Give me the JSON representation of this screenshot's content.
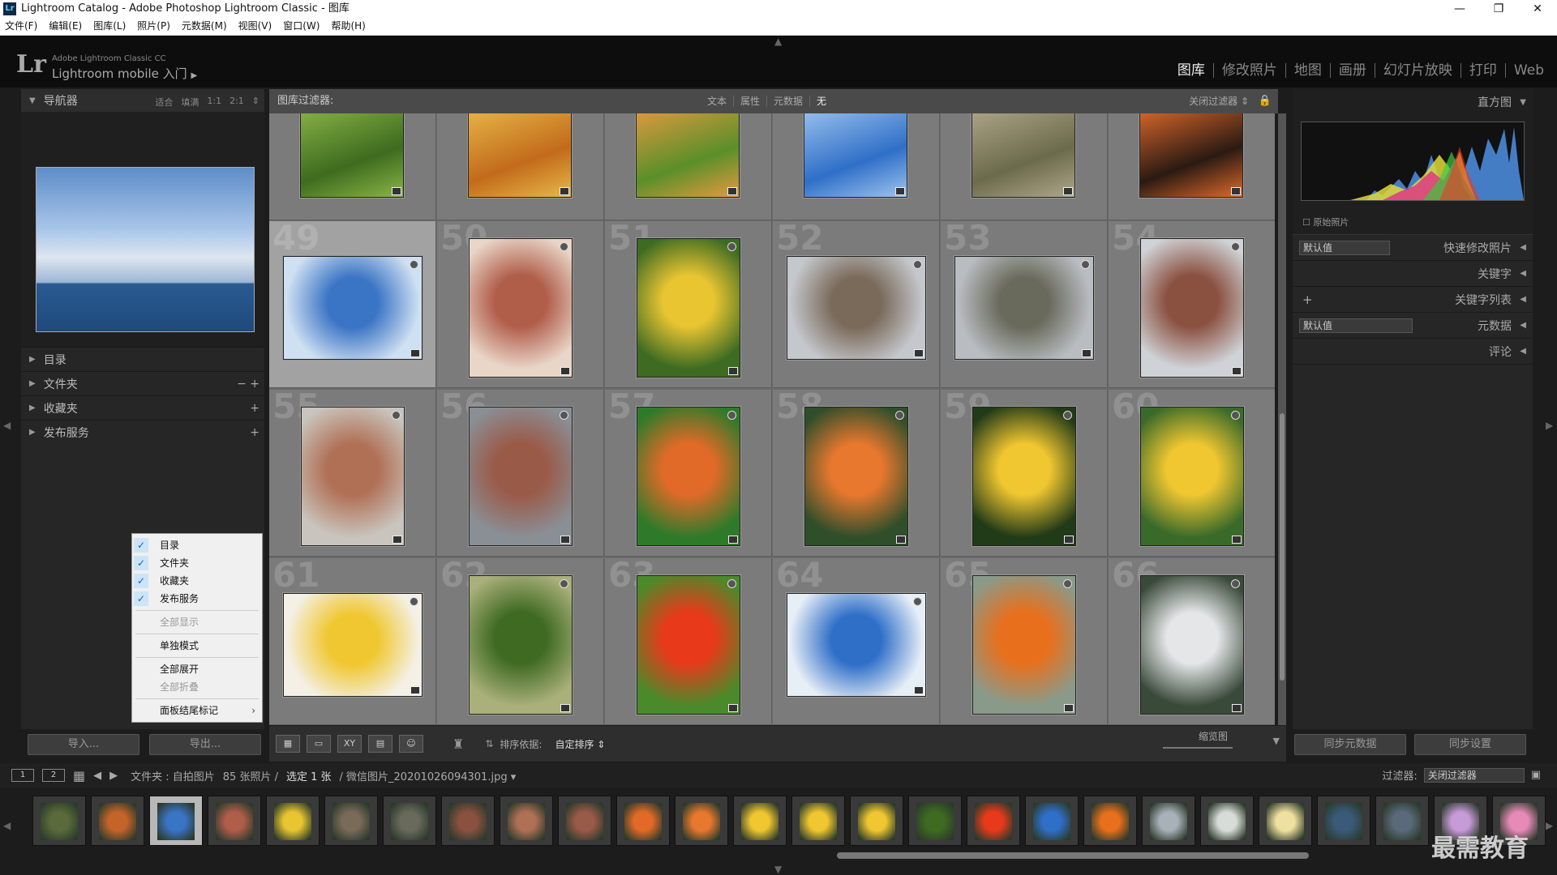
{
  "window": {
    "title": "Lightroom Catalog - Adobe Photoshop Lightroom Classic - 图库",
    "app_icon": "Lr"
  },
  "menubar": [
    "文件(F)",
    "编辑(E)",
    "图库(L)",
    "照片(P)",
    "元数据(M)",
    "视图(V)",
    "窗口(W)",
    "帮助(H)"
  ],
  "identity": {
    "logo": "Lr",
    "line1": "Adobe Lightroom Classic CC",
    "line2": "Lightroom mobile 入门",
    "arrow": "▶"
  },
  "modules": [
    "图库",
    "修改照片",
    "地图",
    "画册",
    "幻灯片放映",
    "打印",
    "Web"
  ],
  "left": {
    "navigator": {
      "title": "导航器",
      "opts": [
        "适合",
        "填满",
        "1:1",
        "2:1"
      ]
    },
    "panels": [
      {
        "label": "目录",
        "acts": ""
      },
      {
        "label": "文件夹",
        "acts": "−  +"
      },
      {
        "label": "收藏夹",
        "acts": "+"
      },
      {
        "label": "发布服务",
        "acts": "+"
      }
    ],
    "import": "导入...",
    "export": "导出..."
  },
  "context_menu": {
    "items": [
      {
        "label": "目录",
        "checked": true
      },
      {
        "label": "文件夹",
        "checked": true
      },
      {
        "label": "收藏夹",
        "checked": true
      },
      {
        "label": "发布服务",
        "checked": true
      }
    ],
    "show_all": "全部显示",
    "solo": "单独模式",
    "expand_all": "全部展开",
    "collapse_all": "全部折叠",
    "end_mark": "面板结尾标记"
  },
  "filter": {
    "label": "图库过滤器:",
    "tabs": [
      "文本",
      "属性",
      "元数据",
      "无"
    ],
    "close": "关闭过滤器 ⇕"
  },
  "grid": {
    "top_row_colors": [
      [
        "#3e6b1e",
        "#8ab548"
      ],
      [
        "#c26b1a",
        "#e8b84a"
      ],
      [
        "#5a8f2a",
        "#e59a3f"
      ],
      [
        "#2f6fc8",
        "#9ec4ee"
      ],
      [
        "#6b6b4b",
        "#b0a78a"
      ],
      [
        "#2a1a12",
        "#e06a2c"
      ]
    ],
    "numbers": [
      "49",
      "50",
      "51",
      "52",
      "53",
      "54",
      "55",
      "56",
      "57",
      "58",
      "59",
      "60",
      "61",
      "62",
      "63",
      "64",
      "65",
      "66"
    ],
    "colors": [
      [
        "#3a74c4",
        "#cfe0f2"
      ],
      [
        "#b05d4a",
        "#e9d6c8"
      ],
      [
        "#e8c531",
        "#3d6b22"
      ],
      [
        "#7a6a5a",
        "#c4c7cc"
      ],
      [
        "#6a6a5c",
        "#b9bdc2"
      ],
      [
        "#8a5040",
        "#cfd2d6"
      ],
      [
        "#b07055",
        "#c9c4bd"
      ],
      [
        "#9a5a48",
        "#8a8f96"
      ],
      [
        "#e26a28",
        "#2f7a2a"
      ],
      [
        "#e8782e",
        "#2f4e2a"
      ],
      [
        "#f0c730",
        "#213a18"
      ],
      [
        "#f0c730",
        "#3a6a2a"
      ],
      [
        "#f0c730",
        "#f4f0e6"
      ],
      [
        "#3f6a22",
        "#aab07a"
      ],
      [
        "#e83a1a",
        "#4a8a2a"
      ],
      [
        "#2f6fc8",
        "#e6eef6"
      ],
      [
        "#e8701c",
        "#8a9a8a"
      ],
      [
        "#e4e6e8",
        "#3a4a3a"
      ]
    ],
    "orient": [
      "l",
      "p",
      "p",
      "l",
      "l",
      "p",
      "p",
      "p",
      "p",
      "p",
      "p",
      "p",
      "l",
      "p",
      "p",
      "l",
      "p",
      "p"
    ]
  },
  "toolbar": {
    "sort_label": "排序依据:",
    "sort_value": "自定排序 ⇕",
    "zoom_label": "缩览图"
  },
  "right": {
    "histogram": "直方图",
    "original": "原始照片",
    "quick_develop": {
      "preset": "默认值",
      "label": "快速修改照片"
    },
    "keywording": "关键字",
    "keyword_list": "关键字列表",
    "metadata": {
      "preset": "默认值",
      "label": "元数据"
    },
    "comments": "评论",
    "sync_meta": "同步元数据",
    "sync_settings": "同步设置"
  },
  "filmbar": {
    "page1": "1",
    "page2": "2",
    "source": "文件夹 : 自拍图片",
    "count": "85 张照片 /",
    "selected": "选定 1 张",
    "file": "/ 微信图片_20201026094301.jpg ▾",
    "filter_label": "过滤器:",
    "filter_value": "关闭过滤器"
  },
  "filmstrip_colors": [
    "#5a6a3a",
    "#c4642a",
    "#3a74c4",
    "#b05d4a",
    "#e8c531",
    "#7a6a5a",
    "#6a6a5c",
    "#8a5040",
    "#b07055",
    "#9a5a48",
    "#e26a28",
    "#e8782e",
    "#f0c730",
    "#f0c730",
    "#f0c730",
    "#3f6a22",
    "#e83a1a",
    "#2f6fc8",
    "#e8701c",
    "#a8b0b8",
    "#d8dcd8",
    "#f0e0a0",
    "#3a5a7a",
    "#5a6a7a",
    "#c89ad8",
    "#e88ab8"
  ],
  "watermark": "最需教育"
}
